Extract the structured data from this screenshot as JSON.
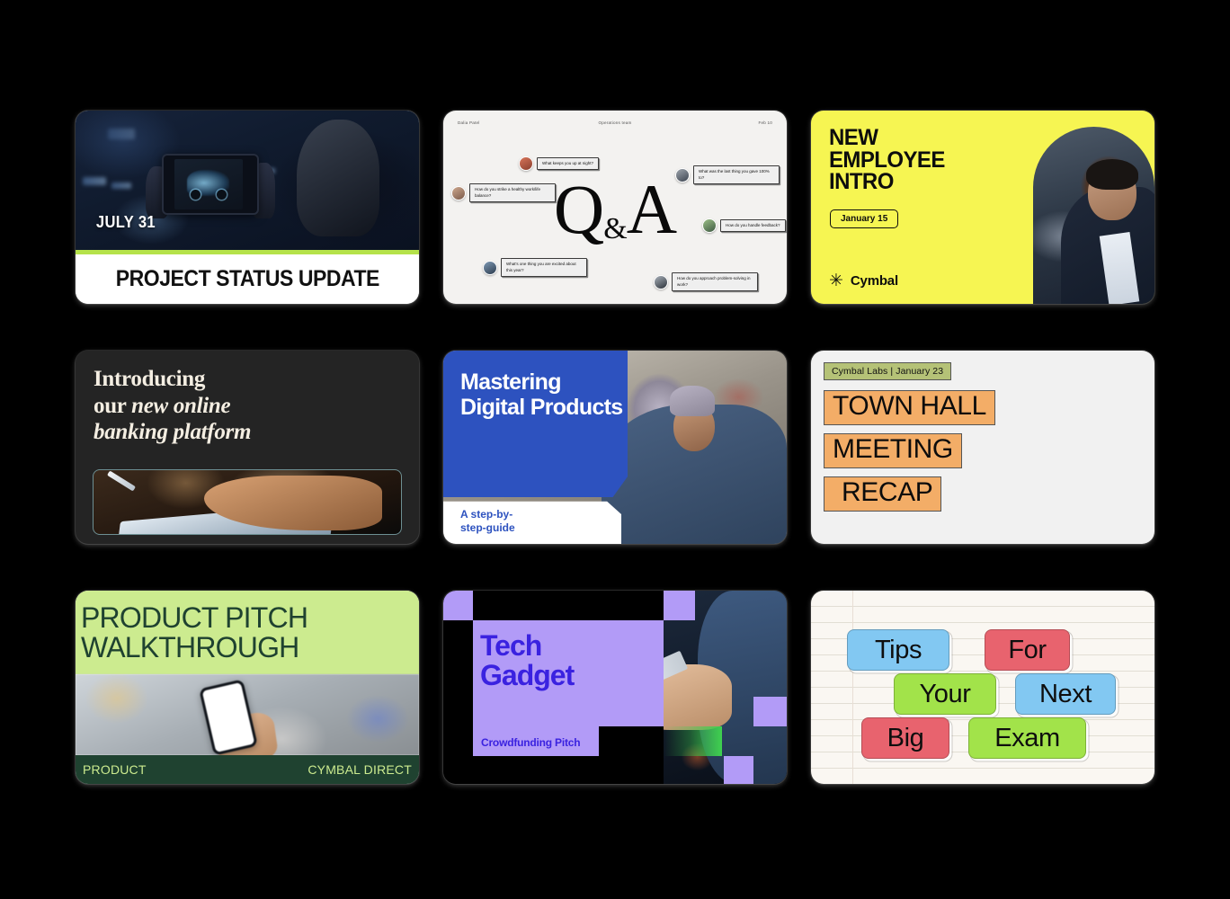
{
  "slides": [
    {
      "id": "project-status-update",
      "date": "JULY 31",
      "title": "PROJECT STATUS UPDATE",
      "accent": "#b5e24a"
    },
    {
      "id": "qa-slide",
      "header": {
        "left": "Dalia Patel",
        "center": "Operations team",
        "right": "Feb 10"
      },
      "big_letter_q": "Q",
      "big_amp": "&",
      "big_letter_a": "A",
      "bubbles": [
        {
          "text": "What keeps you up at night?"
        },
        {
          "text": "What was the last thing you gave 100% to?"
        },
        {
          "text": "How do you strike a healthy work/life balance?"
        },
        {
          "text": "How do you handle feedback?"
        },
        {
          "text": "What's one thing you are excited about this year?"
        },
        {
          "text": "How do you approach problem-solving in work?"
        }
      ]
    },
    {
      "id": "new-employee-intro",
      "line1": "NEW",
      "line2": "EMPLOYEE",
      "line3": "INTRO",
      "date_badge": "January 15",
      "brand": "Cymbal",
      "brand_mark": "✳",
      "bg": "#f6f552"
    },
    {
      "id": "banking-platform",
      "line1": "Introducing",
      "line2_plain": "our ",
      "line2_italic": "new online",
      "line3_italic": "banking platform",
      "bg": "#242424"
    },
    {
      "id": "mastering-digital-products",
      "title": "Mastering Digital Products",
      "subtitle_line1": "A step-by-",
      "subtitle_line2": "step-guide",
      "accent": "#2d52bf"
    },
    {
      "id": "town-hall-recap",
      "tag": "Cymbal Labs  |  January 23",
      "line1": "TOWN HALL",
      "line2": "MEETING",
      "line3": "RECAP",
      "tag_bg": "#b5c277",
      "line_bg": "#f3ad67"
    },
    {
      "id": "product-pitch-walkthrough",
      "line1": "PRODUCT PITCH",
      "line2": "WALKTHROUGH",
      "footer_left": "PRODUCT",
      "footer_right": "CYMBAL DIRECT",
      "band_bg": "#cceb8f",
      "footer_bg": "#1f4230"
    },
    {
      "id": "tech-gadget",
      "title_line1": "Tech",
      "title_line2": "Gadget",
      "subtitle": "Crowdfunding Pitch",
      "accent": "#b29bf7",
      "text_color": "#3a22e0"
    },
    {
      "id": "exam-tips",
      "notes": [
        {
          "text": "Tips",
          "color": "blue"
        },
        {
          "text": "For",
          "color": "red"
        },
        {
          "text": "Your",
          "color": "green"
        },
        {
          "text": "Next",
          "color": "blue"
        },
        {
          "text": "Big",
          "color": "red"
        },
        {
          "text": "Exam",
          "color": "green"
        }
      ]
    }
  ]
}
